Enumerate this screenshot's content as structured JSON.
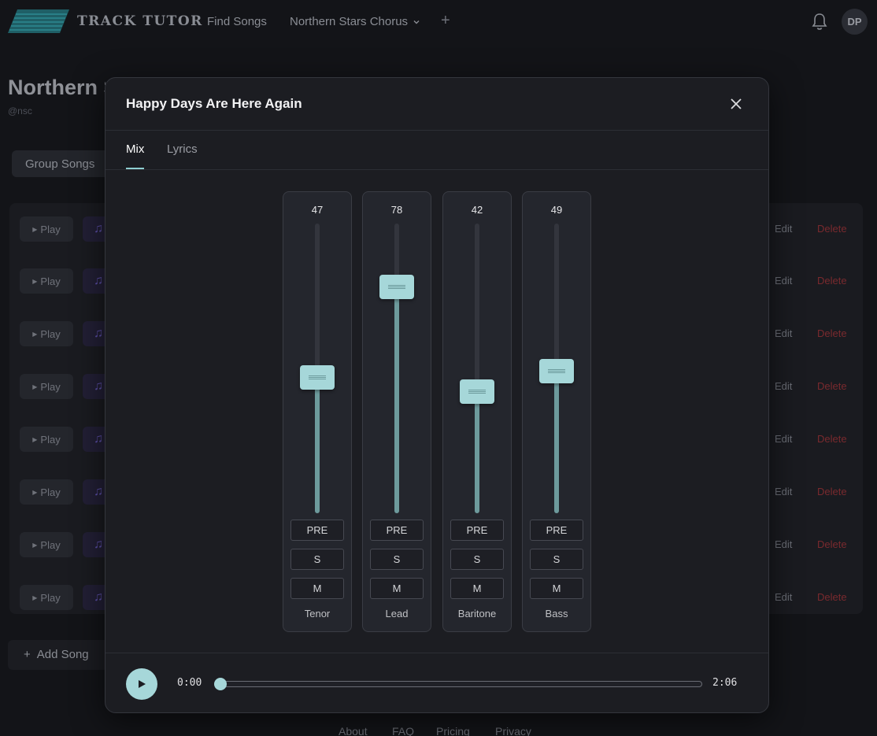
{
  "app": {
    "brand": "TRACK TUTOR",
    "nav": {
      "find_songs": "Find Songs",
      "group": "Northern Stars Chorus",
      "add": "+"
    },
    "user_initials": "DP"
  },
  "page": {
    "title": "Northern Stars Chorus",
    "handle": "@nsc",
    "tab": "Group Songs",
    "rows": [
      {
        "play": "Play",
        "edit": "Edit",
        "delete": "Delete"
      },
      {
        "play": "Play",
        "edit": "Edit",
        "delete": "Delete"
      },
      {
        "play": "Play",
        "edit": "Edit",
        "delete": "Delete"
      },
      {
        "play": "Play",
        "edit": "Edit",
        "delete": "Delete"
      },
      {
        "play": "Play",
        "edit": "Edit",
        "delete": "Delete"
      },
      {
        "play": "Play",
        "edit": "Edit",
        "delete": "Delete"
      },
      {
        "play": "Play",
        "edit": "Edit",
        "delete": "Delete"
      },
      {
        "play": "Play",
        "edit": "Edit",
        "delete": "Delete"
      }
    ],
    "add_song": "Add Song",
    "footer": [
      "About",
      "FAQ",
      "Pricing",
      "Privacy"
    ]
  },
  "modal": {
    "title": "Happy Days Are Here Again",
    "tabs": [
      {
        "label": "Mix",
        "active": true
      },
      {
        "label": "Lyrics",
        "active": false
      }
    ],
    "strips": [
      {
        "name": "Tenor",
        "value": 47,
        "pre": "PRE",
        "solo": "S",
        "mute": "M"
      },
      {
        "name": "Lead",
        "value": 78,
        "pre": "PRE",
        "solo": "S",
        "mute": "M"
      },
      {
        "name": "Baritone",
        "value": 42,
        "pre": "PRE",
        "solo": "S",
        "mute": "M"
      },
      {
        "name": "Bass",
        "value": 49,
        "pre": "PRE",
        "solo": "S",
        "mute": "M"
      }
    ],
    "transport": {
      "current_time": "0:00",
      "duration": "2:06",
      "progress": 0
    }
  },
  "colors": {
    "accent": "#a6d7d9",
    "delete": "#7a2a2e",
    "note": "#5c4fa8"
  }
}
